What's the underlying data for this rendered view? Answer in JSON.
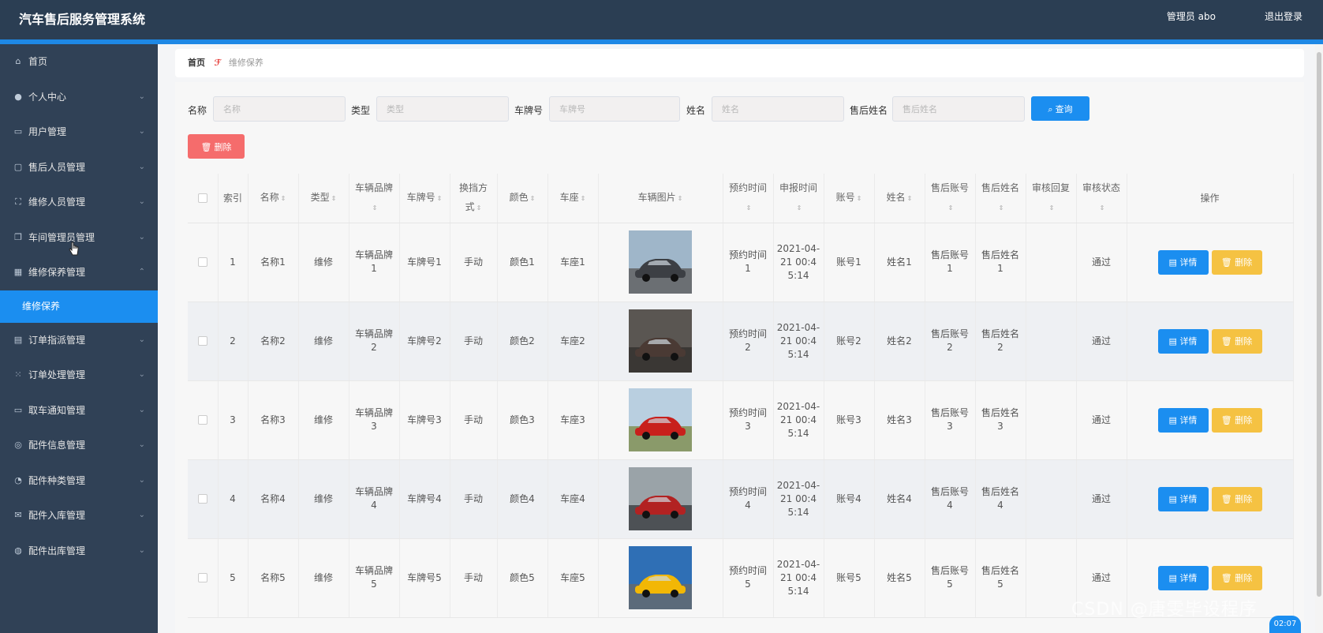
{
  "header": {
    "title": "汽车售后服务管理系统",
    "user": "管理员 abo",
    "logout": "退出登录"
  },
  "colors": {
    "header_bg": "#2b3e53",
    "sidebar_bg": "#304156",
    "accent": "#1b8ef0",
    "danger": "#f56c6c",
    "warning": "#f5c242"
  },
  "sidebar": {
    "items": [
      {
        "label": "首页",
        "icon": "home-icon",
        "expandable": false
      },
      {
        "label": "个人中心",
        "icon": "user-icon",
        "expandable": true
      },
      {
        "label": "用户管理",
        "icon": "briefcase-icon",
        "expandable": true
      },
      {
        "label": "售后人员管理",
        "icon": "chat-icon",
        "expandable": true
      },
      {
        "label": "维修人员管理",
        "icon": "frame-icon",
        "expandable": true
      },
      {
        "label": "车间管理员管理",
        "icon": "copy-icon",
        "expandable": true
      },
      {
        "label": "维修保养管理",
        "icon": "grid-icon",
        "expandable": true,
        "expanded": true
      },
      {
        "label": "维修保养",
        "icon": "",
        "sub": true,
        "active": true
      },
      {
        "label": "订单指派管理",
        "icon": "clipboard-icon",
        "expandable": true
      },
      {
        "label": "订单处理管理",
        "icon": "apps-icon",
        "expandable": true
      },
      {
        "label": "取车通知管理",
        "icon": "message-icon",
        "expandable": true
      },
      {
        "label": "配件信息管理",
        "icon": "target-icon",
        "expandable": true
      },
      {
        "label": "配件种类管理",
        "icon": "compass-icon",
        "expandable": true
      },
      {
        "label": "配件入库管理",
        "icon": "mail-icon",
        "expandable": true
      },
      {
        "label": "配件出库管理",
        "icon": "help-icon",
        "expandable": true
      }
    ]
  },
  "breadcrumb": {
    "home": "首页",
    "current": "维修保养"
  },
  "search": {
    "name_label": "名称",
    "name_placeholder": "名称",
    "type_label": "类型",
    "type_placeholder": "类型",
    "plate_label": "车牌号",
    "plate_placeholder": "车牌号",
    "person_label": "姓名",
    "person_placeholder": "姓名",
    "service_label": "售后姓名",
    "service_placeholder": "售后姓名",
    "query_button": "查询"
  },
  "toolbar": {
    "delete_button": "删除"
  },
  "table": {
    "headers": [
      "",
      "索引",
      "名称",
      "类型",
      "车辆品牌",
      "车牌号",
      "换挡方式",
      "颜色",
      "车座",
      "车辆图片",
      "预约时间",
      "申报时间",
      "账号",
      "姓名",
      "售后账号",
      "售后姓名",
      "审核回复",
      "审核状态",
      "操作"
    ],
    "rows": [
      {
        "index": "1",
        "name": "名称1",
        "type": "维修",
        "brand": "车辆品牌1",
        "plate": "车牌号1",
        "gear": "手动",
        "color": "颜色1",
        "seat": "车座1",
        "appoint": "预约时间1",
        "report": "2021-04-21 00:45:14",
        "account": "账号1",
        "person": "姓名1",
        "service_account": "售后账号1",
        "service_name": "售后姓名1",
        "reply": "",
        "status": "通过",
        "detail": "详情",
        "delete": "删除"
      },
      {
        "index": "2",
        "name": "名称2",
        "type": "维修",
        "brand": "车辆品牌2",
        "plate": "车牌号2",
        "gear": "手动",
        "color": "颜色2",
        "seat": "车座2",
        "appoint": "预约时间2",
        "report": "2021-04-21 00:45:14",
        "account": "账号2",
        "person": "姓名2",
        "service_account": "售后账号2",
        "service_name": "售后姓名2",
        "reply": "",
        "status": "通过",
        "detail": "详情",
        "delete": "删除"
      },
      {
        "index": "3",
        "name": "名称3",
        "type": "维修",
        "brand": "车辆品牌3",
        "plate": "车牌号3",
        "gear": "手动",
        "color": "颜色3",
        "seat": "车座3",
        "appoint": "预约时间3",
        "report": "2021-04-21 00:45:14",
        "account": "账号3",
        "person": "姓名3",
        "service_account": "售后账号3",
        "service_name": "售后姓名3",
        "reply": "",
        "status": "通过",
        "detail": "详情",
        "delete": "删除"
      },
      {
        "index": "4",
        "name": "名称4",
        "type": "维修",
        "brand": "车辆品牌4",
        "plate": "车牌号4",
        "gear": "手动",
        "color": "颜色4",
        "seat": "车座4",
        "appoint": "预约时间4",
        "report": "2021-04-21 00:45:14",
        "account": "账号4",
        "person": "姓名4",
        "service_account": "售后账号4",
        "service_name": "售后姓名4",
        "reply": "",
        "status": "通过",
        "detail": "详情",
        "delete": "删除"
      },
      {
        "index": "5",
        "name": "名称5",
        "type": "维修",
        "brand": "车辆品牌5",
        "plate": "车牌号5",
        "gear": "手动",
        "color": "颜色5",
        "seat": "车座5",
        "appoint": "预约时间5",
        "report": "2021-04-21 00:45:14",
        "account": "账号5",
        "person": "姓名5",
        "service_account": "售后账号5",
        "service_name": "售后姓名5",
        "reply": "",
        "status": "通过",
        "detail": "详情",
        "delete": "删除"
      }
    ]
  },
  "overlay": {
    "watermark": "CSDN @唐雯毕设程序",
    "time": "02:07"
  }
}
